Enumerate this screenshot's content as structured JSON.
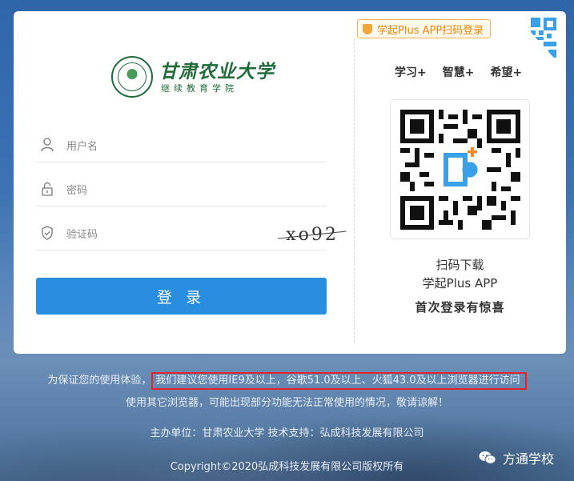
{
  "brand": {
    "logo_cn": "甘肃农业大学",
    "logo_sub": "继续教育学院"
  },
  "form": {
    "username_placeholder": "用户名",
    "password_placeholder": "密码",
    "captcha_placeholder": "验证码",
    "captcha_text": "xo92",
    "login_label": "登 录"
  },
  "app": {
    "scan_tag": "学起Plus APP扫码登录",
    "slogans": [
      "学习+",
      "智慧+",
      "希望+"
    ],
    "qr_line1": "扫码下载",
    "qr_line2": "学起Plus APP",
    "qr_line3": "首次登录有惊喜"
  },
  "footer": {
    "notice_prefix": "为保证您的使用体验，",
    "notice_highlight": "我们建议您使用IE9及以上，谷歌51.0及以上、火狐43.0及以上浏览器进行访问",
    "notice_line2": "使用其它浏览器，可能出现部分功能无法正常使用的情况，敬请谅解！",
    "host": "主办单位：甘肃农业大学  技术支持：弘成科技发展有限公司",
    "copyright": "Copyright©2020弘成科技发展有限公司版权所有"
  },
  "watermark": {
    "label": "方通学校",
    "icon": "wechat-icon"
  },
  "colors": {
    "primary_button": "#2a8ee0",
    "brand_green": "#1f6b3a",
    "tag_orange": "#e8870a",
    "highlight_red": "#e5232a"
  }
}
